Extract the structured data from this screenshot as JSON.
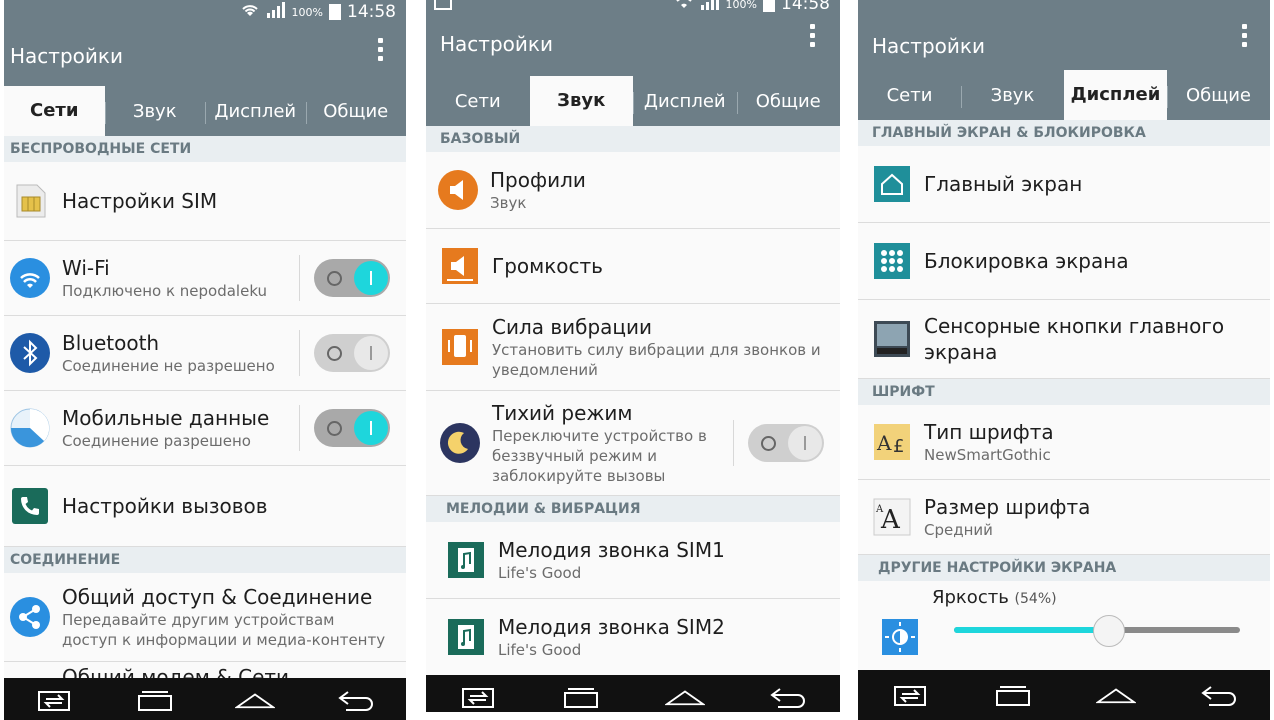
{
  "screens": {
    "p1": {
      "time": "14:58",
      "battery": "100%",
      "title": "Настройки",
      "tabs": [
        "Сети",
        "Звук",
        "Дисплей",
        "Общие"
      ],
      "sections": {
        "wireless": "БЕСПРОВОДНЫЕ СЕТИ",
        "connection": "СОЕДИНЕНИЕ"
      },
      "rows": {
        "sim": "Настройки SIM",
        "wifi_title": "Wi-Fi",
        "wifi_sub": "Подключено к nepodaleku",
        "bt_title": "Bluetooth",
        "bt_sub": "Соединение не разрешено",
        "mobile_title": "Мобильные данные",
        "mobile_sub": "Соединение разрешено",
        "calls": "Настройки вызовов",
        "share_title": "Общий доступ & Соединение",
        "share_sub": "Передавайте другим устройствам доступ к информации и медиа-контенту",
        "modem": "Общий модем & Сети"
      },
      "toggles": {
        "wifi": true,
        "bluetooth": false,
        "mobile": true
      }
    },
    "p2": {
      "time": "14:58",
      "battery": "100%",
      "title": "Настройки",
      "tabs": [
        "Сети",
        "Звук",
        "Дисплей",
        "Общие"
      ],
      "sections": {
        "basic": "БАЗОВЫЙ",
        "melodies": "МЕЛОДИИ & ВИБРАЦИЯ"
      },
      "rows": {
        "profiles_title": "Профили",
        "profiles_sub": "Звук",
        "volume": "Громкость",
        "vibration_title": "Сила вибрации",
        "vibration_sub": "Установить силу вибрации для звонков и уведомлений",
        "silent_title": "Тихий режим",
        "silent_sub": "Переключите устройство в беззвучный режим и заблокируйте вызовы",
        "ring1_title": "Мелодия звонка SIM1",
        "ring1_sub": "Life's Good",
        "ring2_title": "Мелодия звонка SIM2",
        "ring2_sub": "Life's Good"
      },
      "toggles": {
        "silent": false
      }
    },
    "p3": {
      "title": "Настройки",
      "tabs": [
        "Сети",
        "Звук",
        "Дисплей",
        "Общие"
      ],
      "sections": {
        "home": "ГЛАВНЫЙ ЭКРАН & БЛОКИРОВКА",
        "font": "ШРИФТ",
        "other": "ДРУГИЕ НАСТРОЙКИ ЭКРАНА"
      },
      "rows": {
        "home": "Главный экран",
        "lock": "Блокировка экрана",
        "touch": "Сенсорные кнопки главного экрана",
        "font_type_title": "Тип шрифта",
        "font_type_sub": "NewSmartGothic",
        "font_size_title": "Размер шрифта",
        "font_size_sub": "Средний",
        "brightness_title": "Яркость",
        "brightness_value": "(54%)"
      },
      "brightness": 0.54
    }
  },
  "colors": {
    "accent": "#1ed6dc",
    "appbar": "#6d7e87",
    "section_bg": "#e9eef1",
    "navbar": "#111111"
  }
}
